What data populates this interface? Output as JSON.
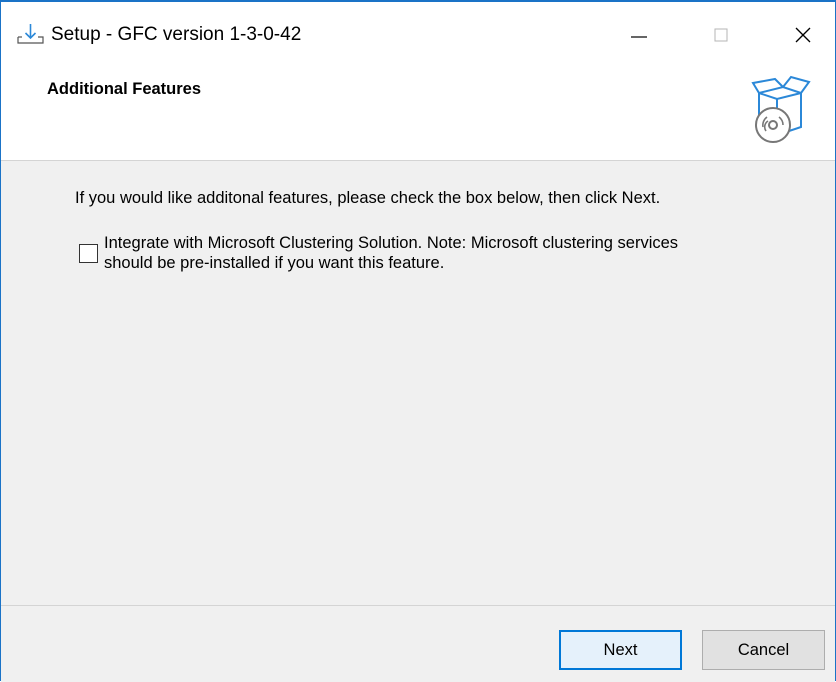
{
  "window": {
    "title": "Setup - GFC version 1-3-0-42",
    "app_icon": "download-setup-icon",
    "controls": {
      "minimize_icon": "minimize-icon",
      "maximize_icon": "maximize-icon",
      "close_icon": "close-icon"
    },
    "accent_color": "#1a73c7"
  },
  "header": {
    "title": "Additional Features",
    "icon": "installer-box-disc-icon"
  },
  "content": {
    "intro": "If you would like additonal features, please check the box below, then click Next.",
    "checkbox": {
      "checked": false,
      "label_line1": "Integrate with Microsoft Clustering Solution. Note: Microsoft clustering services",
      "label_line2": "should be pre-installed if you want this feature."
    }
  },
  "footer": {
    "next_label": "Next",
    "cancel_label": "Cancel"
  }
}
